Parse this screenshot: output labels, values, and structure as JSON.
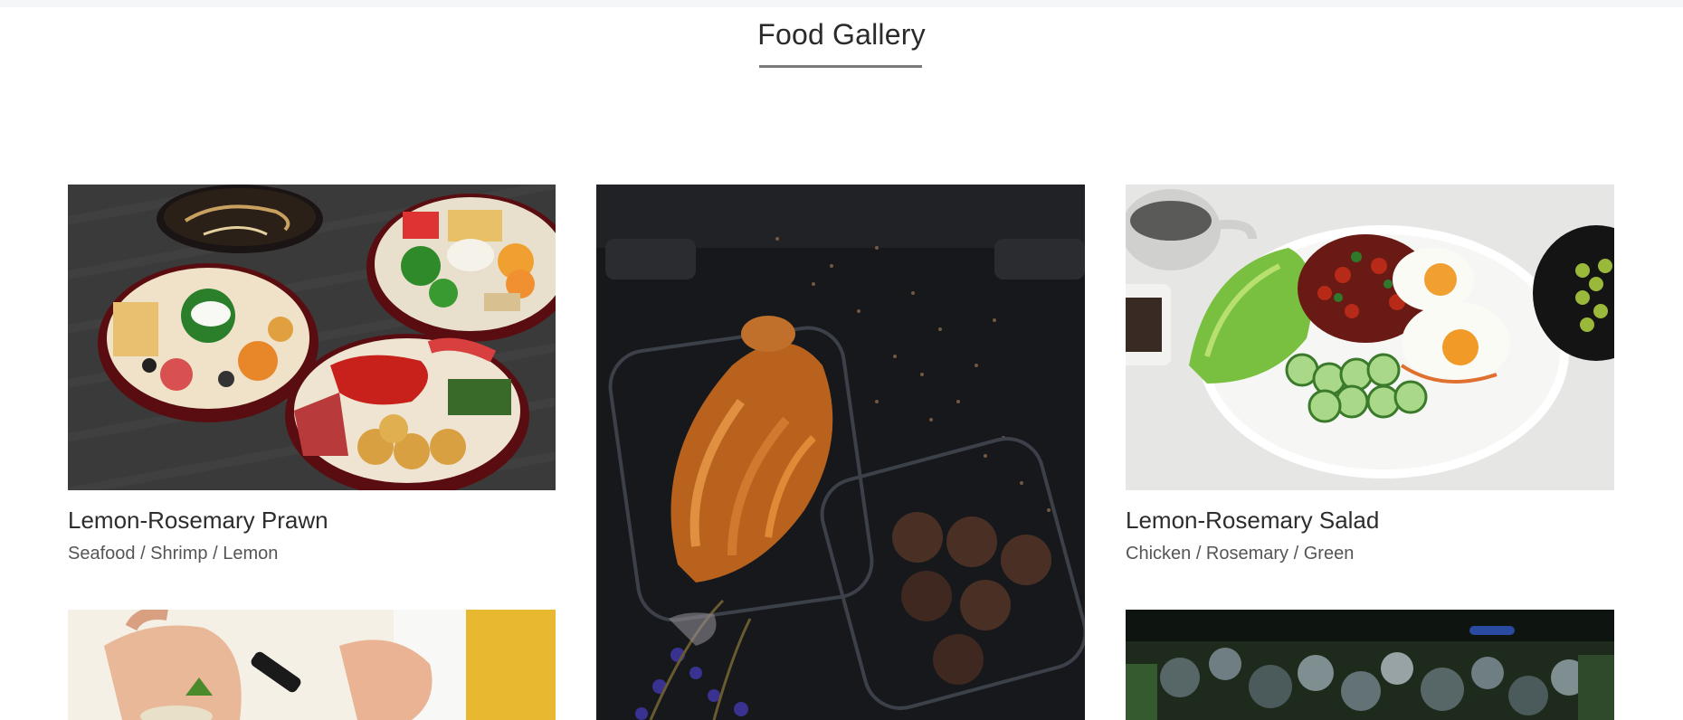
{
  "gallery": {
    "title": "Food Gallery"
  },
  "items": [
    {
      "title": "Lemon-Rosemary Prawn",
      "tags": "Seafood / Shrimp / Lemon",
      "image": "bento-seafood-platter"
    },
    {
      "title": "",
      "tags": "",
      "image": "croissant-and-chocolate-balls"
    },
    {
      "title": "Lemon-Rosemary Salad",
      "tags": "Chicken / Rosemary / Green",
      "image": "beans-eggs-salad-plate"
    },
    {
      "title": "",
      "tags": "",
      "image": "hands-cutting-food"
    },
    {
      "title": "",
      "tags": "",
      "image": "blurred-bokeh-food"
    }
  ]
}
